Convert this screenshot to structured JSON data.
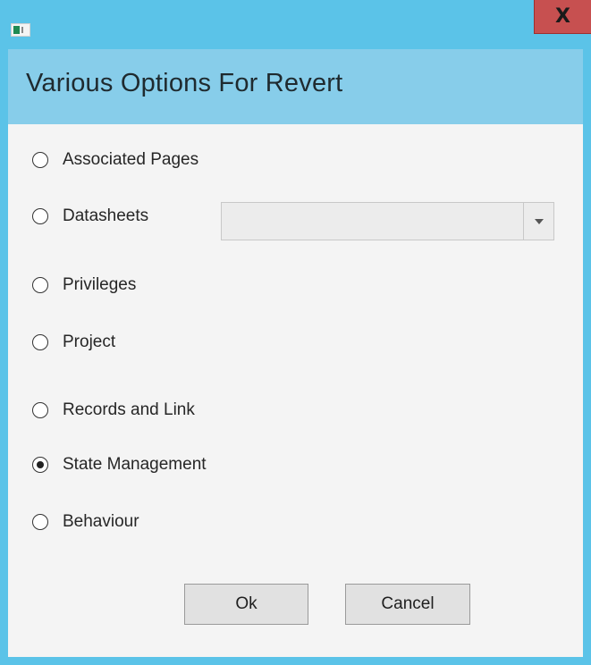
{
  "window": {
    "close_label": "X"
  },
  "header": {
    "title": "Various Options For Revert"
  },
  "options": [
    {
      "label": "Associated Pages",
      "checked": false
    },
    {
      "label": "Datasheets",
      "checked": false
    },
    {
      "label": "Privileges",
      "checked": false
    },
    {
      "label": "Project",
      "checked": false
    },
    {
      "label": "Records and Link",
      "checked": false
    },
    {
      "label": "State Management",
      "checked": true
    },
    {
      "label": "Behaviour",
      "checked": false
    }
  ],
  "datasheet_combo": {
    "value": "",
    "icon": "chevron-down-icon"
  },
  "buttons": {
    "ok_label": "Ok",
    "cancel_label": "Cancel"
  },
  "colors": {
    "titlebar": "#5bc3e8",
    "header_band": "#87cdea",
    "close_button": "#c75050",
    "content_bg": "#f4f4f4"
  }
}
